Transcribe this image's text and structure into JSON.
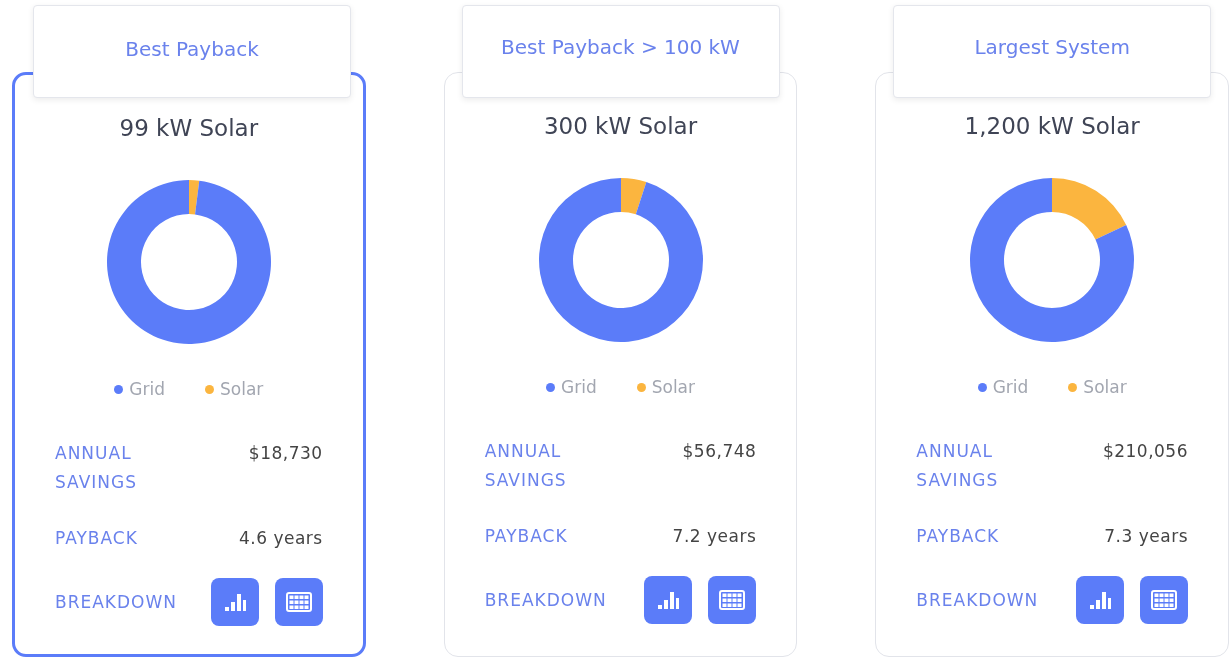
{
  "cards": [
    {
      "tab": "Best Payback",
      "selected": true,
      "title": "99 kW Solar",
      "chart_data": {
        "type": "donut",
        "categories": [
          "Grid",
          "Solar"
        ],
        "values": [
          98,
          2
        ],
        "colors": [
          "#5b7cf9",
          "#fbb53f"
        ]
      },
      "rows": [
        {
          "label": "ANNUAL SAVINGS",
          "value": "$18,730"
        },
        {
          "label": "PAYBACK",
          "value": "4.6 years"
        }
      ],
      "breakdown": "BREAKDOWN"
    },
    {
      "tab": "Best Payback > 100 kW",
      "selected": false,
      "title": "300 kW Solar",
      "chart_data": {
        "type": "donut",
        "categories": [
          "Grid",
          "Solar"
        ],
        "values": [
          95,
          5
        ],
        "colors": [
          "#5b7cf9",
          "#fbb53f"
        ]
      },
      "rows": [
        {
          "label": "ANNUAL SAVINGS",
          "value": "$56,748"
        },
        {
          "label": "PAYBACK",
          "value": "7.2 years"
        }
      ],
      "breakdown": "BREAKDOWN"
    },
    {
      "tab": "Largest System",
      "selected": false,
      "title": "1,200 kW Solar",
      "chart_data": {
        "type": "donut",
        "categories": [
          "Grid",
          "Solar"
        ],
        "values": [
          82,
          18
        ],
        "colors": [
          "#5b7cf9",
          "#fbb53f"
        ]
      },
      "rows": [
        {
          "label": "ANNUAL SAVINGS",
          "value": "$210,056"
        },
        {
          "label": "PAYBACK",
          "value": "7.3 years"
        }
      ],
      "breakdown": "BREAKDOWN"
    }
  ]
}
